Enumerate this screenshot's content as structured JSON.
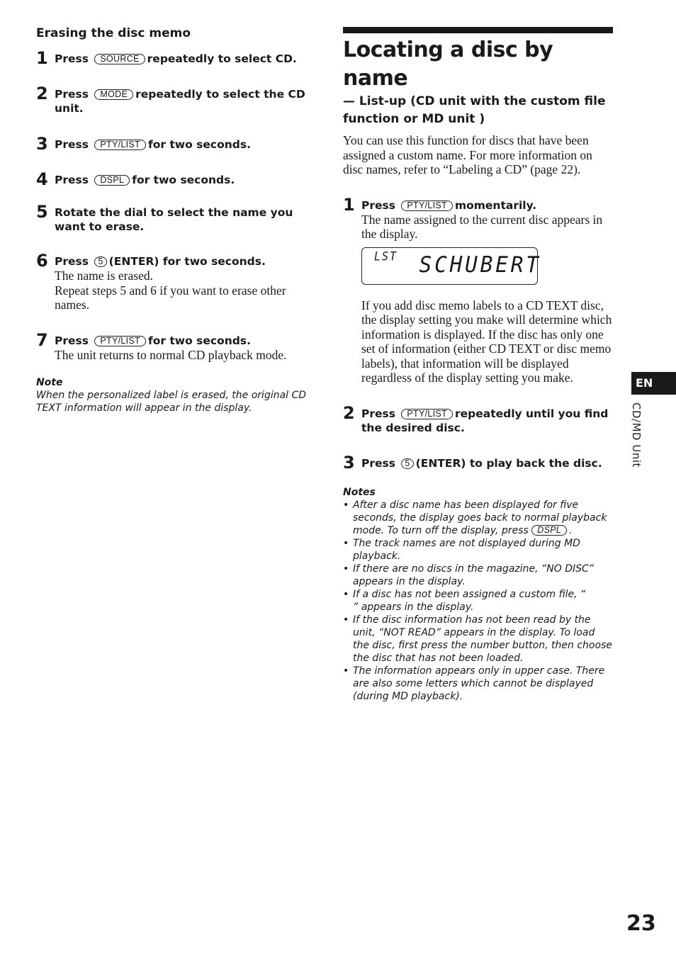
{
  "left": {
    "heading": "Erasing the disc memo",
    "steps": [
      {
        "num": "1",
        "pre": "Press",
        "button": "SOURCE",
        "post": "repeatedly to select CD.",
        "body": []
      },
      {
        "num": "2",
        "pre": "Press",
        "button": "MODE",
        "post": "repeatedly to select the CD unit.",
        "body": []
      },
      {
        "num": "3",
        "pre": "Press",
        "button": "PTY/LIST",
        "post": "for two seconds.",
        "body": []
      },
      {
        "num": "4",
        "pre": "Press",
        "button": "DSPL",
        "post": "for two seconds.",
        "body": []
      },
      {
        "num": "5",
        "text": "Rotate the dial to select the name you want to erase.",
        "body": []
      },
      {
        "num": "6",
        "pre": "Press",
        "button": "5",
        "post": "(ENTER) for two seconds.",
        "body": [
          "The name is erased.",
          "Repeat steps 5 and 6 if you want to erase other names."
        ]
      },
      {
        "num": "7",
        "pre": "Press",
        "button": "PTY/LIST",
        "post": "for two seconds.",
        "body": [
          "The unit returns to normal CD playback mode."
        ]
      }
    ],
    "note": {
      "title": "Note",
      "text": "When the personalized label is erased, the original CD TEXT information will appear in the display."
    }
  },
  "right": {
    "title": "Locating a disc by name",
    "subtitle": "— List-up (CD unit with the custom file function or MD unit )",
    "intro": "You can use this function for discs that have been assigned a custom name. For more information on disc names, refer to “Labeling a CD” (page 22).",
    "steps": [
      {
        "num": "1",
        "pre": "Press",
        "button": "PTY/LIST",
        "post": "momentarily.",
        "body": "The name assigned to the current disc appears in the display.",
        "extra": "If you add disc memo labels to a CD TEXT disc, the display setting you make will determine which information is displayed. If the disc has only one set of information (either CD TEXT or disc memo labels), that information will be displayed regardless of the display setting you make."
      },
      {
        "num": "2",
        "pre": "Press",
        "button": "PTY/LIST",
        "post": "repeatedly until you find the desired disc."
      },
      {
        "num": "3",
        "pre": "Press",
        "button": "5",
        "post": "(ENTER) to play back the disc."
      }
    ],
    "display": {
      "indicator": "LST",
      "text": "SCHUBERT"
    },
    "notes": {
      "title": "Notes",
      "items": [
        {
          "pre": "After a disc name has been displayed for five seconds, the display goes back to normal playback mode. To turn off the display, press",
          "button": "DSPL",
          "post": "."
        },
        {
          "pre": "The track names are not displayed during MD playback."
        },
        {
          "pre": "If there are no discs in the magazine, “NO DISC” appears in the display."
        },
        {
          "pre": "If a disc has not been assigned a custom file, “          ” appears in the display."
        },
        {
          "pre": "If the disc information has not been read by the unit, “NOT READ” appears in the display. To load the disc, first press the number button, then choose the disc that has not been loaded."
        },
        {
          "pre": "The information appears only in upper case. There are also some letters which cannot be displayed (during MD playback)."
        }
      ]
    }
  },
  "side": {
    "lang_tab": "EN",
    "section": "CD/MD Unit"
  },
  "page_number": "23"
}
